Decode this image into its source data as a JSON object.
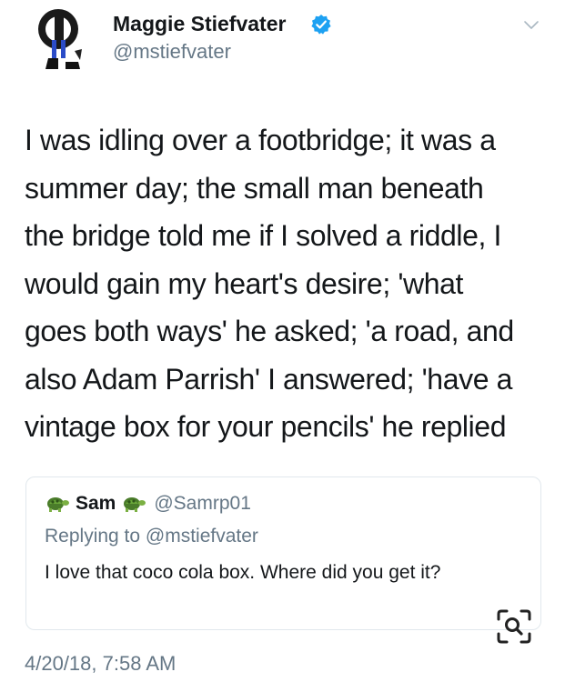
{
  "author": {
    "name": "Maggie Stiefvater",
    "handle": "@mstiefvater",
    "verified_color": "#1da1f2"
  },
  "tweet": {
    "lines": [
      "I was idling over a footbridge; it was a",
      "summer day; the small man beneath",
      "the bridge told me if I solved a riddle, I",
      "would gain my heart's desire; 'what",
      "goes both ways' he asked; 'a road, and",
      "also Adam Parrish' I answered; 'have a",
      "vintage box for your pencils' he replied"
    ],
    "timestamp": "4/20/18, 7:58 AM"
  },
  "quoted_tweet": {
    "name": "Sam",
    "handle": "@Samrp01",
    "replying_prefix": "Replying to",
    "replying_to": "@mstiefvater",
    "text": "I love that coco cola box. Where did you get it?",
    "name_emoji": "turtle-icon"
  },
  "icons": {
    "menu": "chevron-down-icon",
    "lens": "visual-search-icon"
  },
  "colors": {
    "text": "#14171a",
    "secondary": "#657786",
    "border": "#e1e8ed",
    "verified": "#1da1f2"
  }
}
